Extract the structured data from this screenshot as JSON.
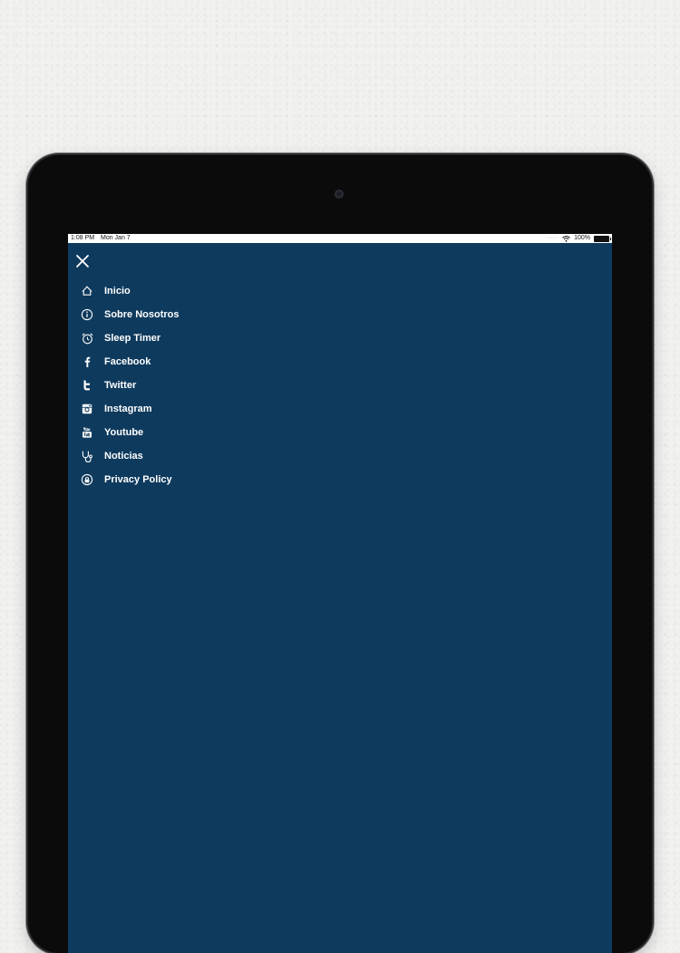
{
  "status_bar": {
    "time": "1:08 PM",
    "date": "Mon Jan 7",
    "battery": "100%"
  },
  "menu": {
    "items": [
      {
        "label": "Inicio",
        "icon": "house-icon"
      },
      {
        "label": "Sobre Nosotros",
        "icon": "info-icon"
      },
      {
        "label": "Sleep Timer",
        "icon": "alarm-clock-icon"
      },
      {
        "label": "Facebook",
        "icon": "facebook-icon"
      },
      {
        "label": "Twitter",
        "icon": "twitter-icon"
      },
      {
        "label": "Instagram",
        "icon": "instagram-icon"
      },
      {
        "label": "Youtube",
        "icon": "youtube-icon"
      },
      {
        "label": "Noticias",
        "icon": "stethoscope-icon"
      },
      {
        "label": "Privacy Policy",
        "icon": "lock-icon"
      }
    ]
  },
  "colors": {
    "screen_background": "#0e3a5d",
    "text": "#ffffff",
    "status_bar": "#ffffff"
  }
}
